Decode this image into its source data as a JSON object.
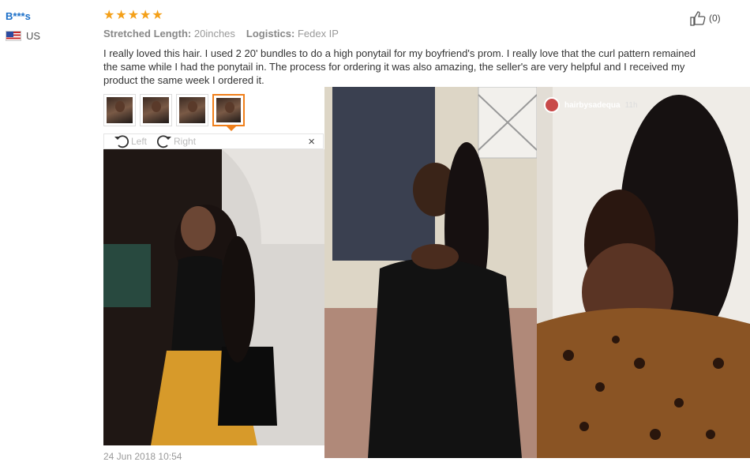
{
  "reviewer": {
    "name": "B***s",
    "country": "US"
  },
  "rating": {
    "stars": 5
  },
  "meta": {
    "length_label": "Stretched Length:",
    "length_value": "20inches",
    "logistics_label": "Logistics:",
    "logistics_value": "Fedex IP"
  },
  "review_text": "I really loved this hair. I used 2 20' bundles to do a high ponytail for my boyfriend's prom. I really love that the curl pattern remained the same while I had the ponytail in. The process for ordering it was also amazing, the seller's are very helpful and I received my product the same week I ordered it.",
  "helpful": {
    "count": "(0)"
  },
  "viewer": {
    "left_label": "Left",
    "right_label": "Right",
    "close_label": "×"
  },
  "date": "24 Jun 2018 10:54",
  "instagram": {
    "handle": "hairbysadequa",
    "time": "11h"
  },
  "photos": [
    "photo-1",
    "photo-2",
    "photo-3"
  ],
  "thumbnails": 4,
  "colors": {
    "accent": "#f07f1a",
    "link": "#1b6fc8",
    "star": "#f4a019"
  }
}
